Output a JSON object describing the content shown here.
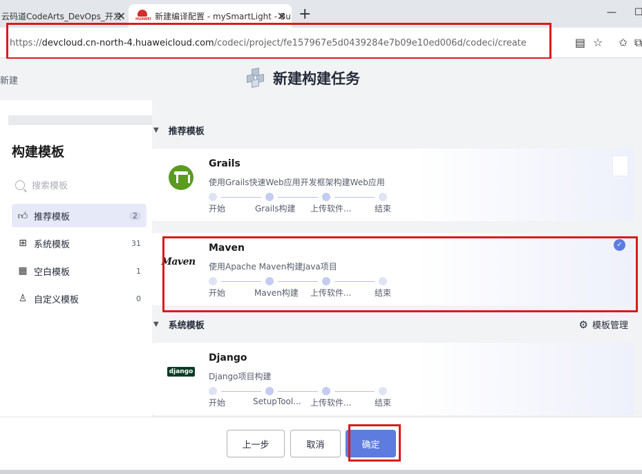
{
  "browser": {
    "tabs": [
      {
        "title": "云码道CodeArts_DevOps_开发"
      },
      {
        "title": "新建编译配置 - mySmartLight - Bu"
      }
    ],
    "url_scheme": "https://",
    "url_host": "devcloud.cn-north-4.huaweicloud.com",
    "url_path": "/codeci/project/fe157967e5d0439284e7b09e10ed006d/codeci/create"
  },
  "breadcrumb": "新建",
  "page_title": "新建构建任务",
  "sidebar": {
    "title": "构建模板",
    "search_placeholder": "搜索模板",
    "items": [
      {
        "label": "推荐模板",
        "count": "2",
        "active": true
      },
      {
        "label": "系统模板",
        "count": "31"
      },
      {
        "label": "空白模板",
        "count": "1"
      },
      {
        "label": "自定义模板",
        "count": "0"
      }
    ]
  },
  "sections": {
    "recommended": "推荐模板",
    "system": "系统模板",
    "manage": "模板管理"
  },
  "cards": [
    {
      "name": "Grails",
      "desc": "使用Grails快速Web应用开发框架构建Web应用",
      "steps": [
        "开始",
        "Grails构建",
        "上传软件...",
        "结束"
      ],
      "selected": false
    },
    {
      "name": "Maven",
      "logo_text": "Maven",
      "desc": "使用Apache Maven构建Java项目",
      "steps": [
        "开始",
        "Maven构建",
        "上传软件...",
        "结束"
      ],
      "selected": true
    },
    {
      "name": "Django",
      "logo_text": "django",
      "desc": "Django项目构建",
      "steps": [
        "开始",
        "SetupTool...",
        "上传软件...",
        "结束"
      ],
      "selected": false
    }
  ],
  "footer": {
    "prev": "上一步",
    "cancel": "取消",
    "confirm": "确定"
  },
  "colors": {
    "accent": "#5e7ce0",
    "highlight": "#d81b1b",
    "active_bg": "#e6eaf8"
  }
}
